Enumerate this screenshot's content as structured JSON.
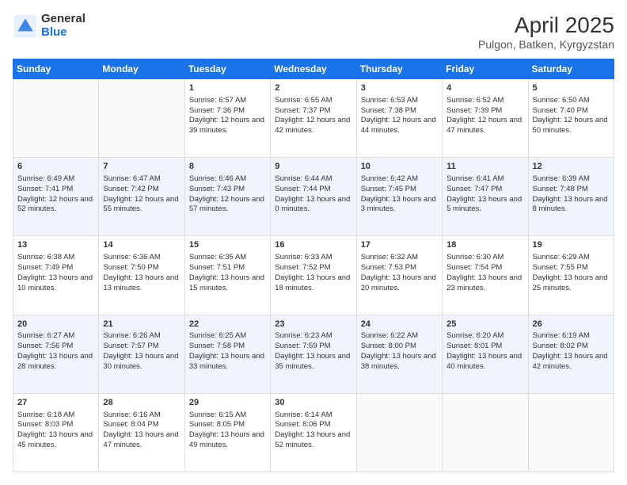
{
  "logo": {
    "general": "General",
    "blue": "Blue"
  },
  "title": {
    "month": "April 2025",
    "location": "Pulgon, Batken, Kyrgyzstan"
  },
  "headers": [
    "Sunday",
    "Monday",
    "Tuesday",
    "Wednesday",
    "Thursday",
    "Friday",
    "Saturday"
  ],
  "weeks": [
    [
      {
        "day": "",
        "sunrise": "",
        "sunset": "",
        "daylight": ""
      },
      {
        "day": "",
        "sunrise": "",
        "sunset": "",
        "daylight": ""
      },
      {
        "day": "1",
        "sunrise": "Sunrise: 6:57 AM",
        "sunset": "Sunset: 7:36 PM",
        "daylight": "Daylight: 12 hours and 39 minutes."
      },
      {
        "day": "2",
        "sunrise": "Sunrise: 6:55 AM",
        "sunset": "Sunset: 7:37 PM",
        "daylight": "Daylight: 12 hours and 42 minutes."
      },
      {
        "day": "3",
        "sunrise": "Sunrise: 6:53 AM",
        "sunset": "Sunset: 7:38 PM",
        "daylight": "Daylight: 12 hours and 44 minutes."
      },
      {
        "day": "4",
        "sunrise": "Sunrise: 6:52 AM",
        "sunset": "Sunset: 7:39 PM",
        "daylight": "Daylight: 12 hours and 47 minutes."
      },
      {
        "day": "5",
        "sunrise": "Sunrise: 6:50 AM",
        "sunset": "Sunset: 7:40 PM",
        "daylight": "Daylight: 12 hours and 50 minutes."
      }
    ],
    [
      {
        "day": "6",
        "sunrise": "Sunrise: 6:49 AM",
        "sunset": "Sunset: 7:41 PM",
        "daylight": "Daylight: 12 hours and 52 minutes."
      },
      {
        "day": "7",
        "sunrise": "Sunrise: 6:47 AM",
        "sunset": "Sunset: 7:42 PM",
        "daylight": "Daylight: 12 hours and 55 minutes."
      },
      {
        "day": "8",
        "sunrise": "Sunrise: 6:46 AM",
        "sunset": "Sunset: 7:43 PM",
        "daylight": "Daylight: 12 hours and 57 minutes."
      },
      {
        "day": "9",
        "sunrise": "Sunrise: 6:44 AM",
        "sunset": "Sunset: 7:44 PM",
        "daylight": "Daylight: 13 hours and 0 minutes."
      },
      {
        "day": "10",
        "sunrise": "Sunrise: 6:42 AM",
        "sunset": "Sunset: 7:45 PM",
        "daylight": "Daylight: 13 hours and 3 minutes."
      },
      {
        "day": "11",
        "sunrise": "Sunrise: 6:41 AM",
        "sunset": "Sunset: 7:47 PM",
        "daylight": "Daylight: 13 hours and 5 minutes."
      },
      {
        "day": "12",
        "sunrise": "Sunrise: 6:39 AM",
        "sunset": "Sunset: 7:48 PM",
        "daylight": "Daylight: 13 hours and 8 minutes."
      }
    ],
    [
      {
        "day": "13",
        "sunrise": "Sunrise: 6:38 AM",
        "sunset": "Sunset: 7:49 PM",
        "daylight": "Daylight: 13 hours and 10 minutes."
      },
      {
        "day": "14",
        "sunrise": "Sunrise: 6:36 AM",
        "sunset": "Sunset: 7:50 PM",
        "daylight": "Daylight: 13 hours and 13 minutes."
      },
      {
        "day": "15",
        "sunrise": "Sunrise: 6:35 AM",
        "sunset": "Sunset: 7:51 PM",
        "daylight": "Daylight: 13 hours and 15 minutes."
      },
      {
        "day": "16",
        "sunrise": "Sunrise: 6:33 AM",
        "sunset": "Sunset: 7:52 PM",
        "daylight": "Daylight: 13 hours and 18 minutes."
      },
      {
        "day": "17",
        "sunrise": "Sunrise: 6:32 AM",
        "sunset": "Sunset: 7:53 PM",
        "daylight": "Daylight: 13 hours and 20 minutes."
      },
      {
        "day": "18",
        "sunrise": "Sunrise: 6:30 AM",
        "sunset": "Sunset: 7:54 PM",
        "daylight": "Daylight: 13 hours and 23 minutes."
      },
      {
        "day": "19",
        "sunrise": "Sunrise: 6:29 AM",
        "sunset": "Sunset: 7:55 PM",
        "daylight": "Daylight: 13 hours and 25 minutes."
      }
    ],
    [
      {
        "day": "20",
        "sunrise": "Sunrise: 6:27 AM",
        "sunset": "Sunset: 7:56 PM",
        "daylight": "Daylight: 13 hours and 28 minutes."
      },
      {
        "day": "21",
        "sunrise": "Sunrise: 6:26 AM",
        "sunset": "Sunset: 7:57 PM",
        "daylight": "Daylight: 13 hours and 30 minutes."
      },
      {
        "day": "22",
        "sunrise": "Sunrise: 6:25 AM",
        "sunset": "Sunset: 7:58 PM",
        "daylight": "Daylight: 13 hours and 33 minutes."
      },
      {
        "day": "23",
        "sunrise": "Sunrise: 6:23 AM",
        "sunset": "Sunset: 7:59 PM",
        "daylight": "Daylight: 13 hours and 35 minutes."
      },
      {
        "day": "24",
        "sunrise": "Sunrise: 6:22 AM",
        "sunset": "Sunset: 8:00 PM",
        "daylight": "Daylight: 13 hours and 38 minutes."
      },
      {
        "day": "25",
        "sunrise": "Sunrise: 6:20 AM",
        "sunset": "Sunset: 8:01 PM",
        "daylight": "Daylight: 13 hours and 40 minutes."
      },
      {
        "day": "26",
        "sunrise": "Sunrise: 6:19 AM",
        "sunset": "Sunset: 8:02 PM",
        "daylight": "Daylight: 13 hours and 42 minutes."
      }
    ],
    [
      {
        "day": "27",
        "sunrise": "Sunrise: 6:18 AM",
        "sunset": "Sunset: 8:03 PM",
        "daylight": "Daylight: 13 hours and 45 minutes."
      },
      {
        "day": "28",
        "sunrise": "Sunrise: 6:16 AM",
        "sunset": "Sunset: 8:04 PM",
        "daylight": "Daylight: 13 hours and 47 minutes."
      },
      {
        "day": "29",
        "sunrise": "Sunrise: 6:15 AM",
        "sunset": "Sunset: 8:05 PM",
        "daylight": "Daylight: 13 hours and 49 minutes."
      },
      {
        "day": "30",
        "sunrise": "Sunrise: 6:14 AM",
        "sunset": "Sunset: 8:06 PM",
        "daylight": "Daylight: 13 hours and 52 minutes."
      },
      {
        "day": "",
        "sunrise": "",
        "sunset": "",
        "daylight": ""
      },
      {
        "day": "",
        "sunrise": "",
        "sunset": "",
        "daylight": ""
      },
      {
        "day": "",
        "sunrise": "",
        "sunset": "",
        "daylight": ""
      }
    ]
  ]
}
